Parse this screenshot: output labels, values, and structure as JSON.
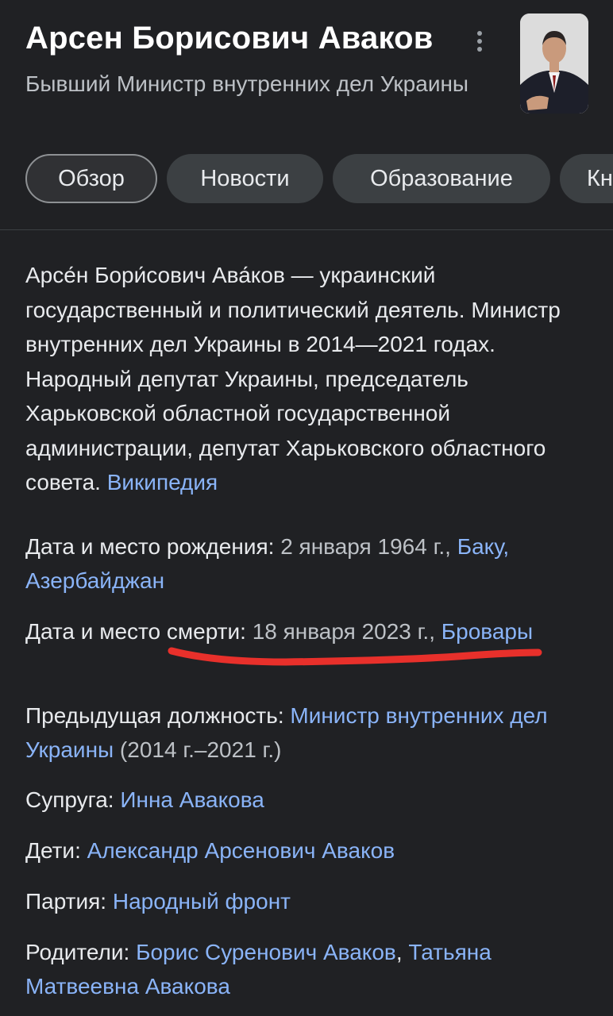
{
  "header": {
    "title": "Арсен Борисович Аваков",
    "subtitle": "Бывший Министр внутренних дел Украины",
    "more_icon": "more-vert-icon"
  },
  "tabs": [
    {
      "label": "Обзор",
      "active": true
    },
    {
      "label": "Новости",
      "active": false
    },
    {
      "label": "Образование",
      "active": false
    },
    {
      "label": "Кн",
      "active": false
    }
  ],
  "description": {
    "text": "Арсе́н Бори́сович Ава́ков — украинский государственный и политический деятель. Министр внутренних дел Украины в 2014—2021 годах. Народный депутат Украины, председатель Харьковской областной государственной администрации, депутат Харьковского областного совета. ",
    "source_link": "Википедия"
  },
  "facts": {
    "birth": {
      "label": "Дата и место рождения: ",
      "value": "2 января 1964 г., ",
      "link": "Баку, Азербайджан"
    },
    "death": {
      "label": "Дата и место смерти: ",
      "value": "18 января 2023 г., ",
      "link": "Бровары"
    },
    "previous_position": {
      "label": "Предыдущая должность: ",
      "link": "Министр внутренних дел Украины",
      "value": " (2014 г.–2021 г.)"
    },
    "spouse": {
      "label": "Супруга: ",
      "link": "Инна Авакова"
    },
    "children": {
      "label": "Дети: ",
      "link": "Александр Арсенович Аваков"
    },
    "party": {
      "label": "Партия: ",
      "link": "Народный фронт"
    },
    "parents": {
      "label": "Родители: ",
      "link1": "Борис Суренович Аваков",
      "separator": ", ",
      "link2": "Татьяна Матвеевна Авакова"
    }
  },
  "colors": {
    "background": "#202124",
    "link": "#8ab4f8",
    "annotation": "#e8302b"
  }
}
